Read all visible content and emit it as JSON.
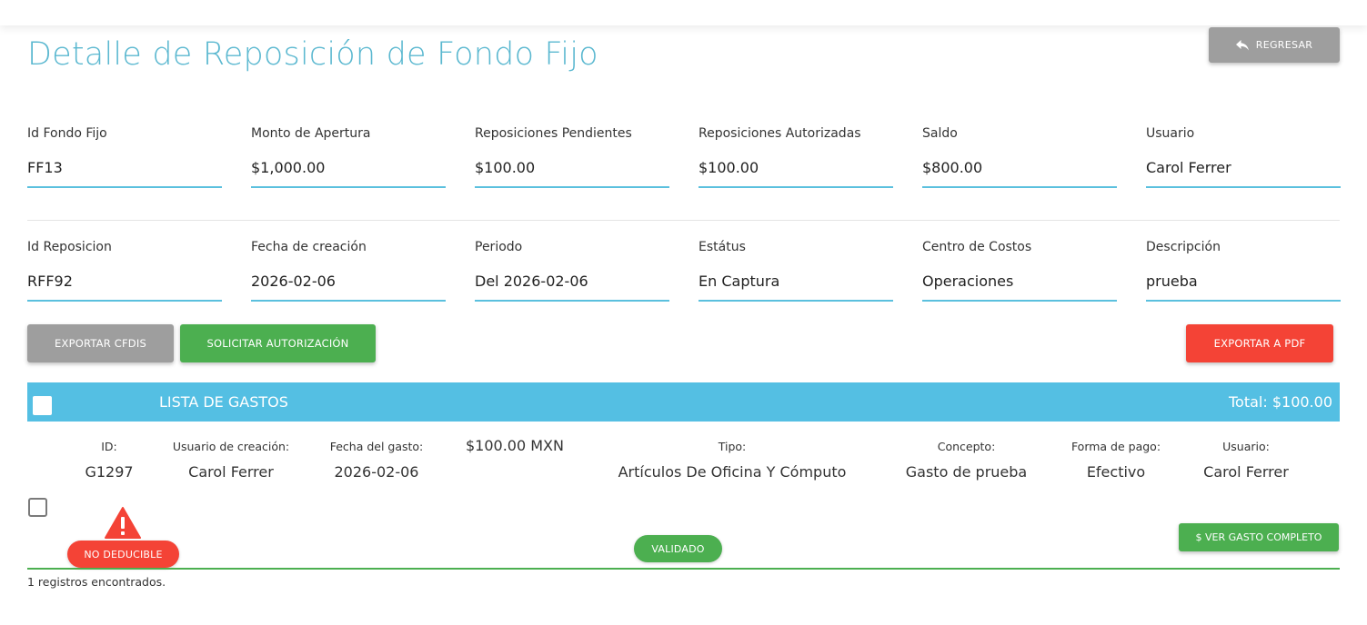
{
  "page": {
    "title": "Detalle de Reposición de Fondo Fijo",
    "back_label": "REGRESAR"
  },
  "summary": {
    "row1": [
      {
        "label": "Id Fondo Fijo",
        "value": "FF13"
      },
      {
        "label": "Monto de Apertura",
        "value": "$1,000.00"
      },
      {
        "label": "Reposiciones Pendientes",
        "value": "$100.00"
      },
      {
        "label": "Reposiciones Autorizadas",
        "value": "$100.00"
      },
      {
        "label": "Saldo",
        "value": "$800.00"
      },
      {
        "label": "Usuario",
        "value": "Carol Ferrer"
      }
    ],
    "row2": [
      {
        "label": "Id Reposicion",
        "value": "RFF92"
      },
      {
        "label": "Fecha de creación",
        "value": "2026-02-06"
      },
      {
        "label": "Periodo",
        "value": "Del 2026-02-06"
      },
      {
        "label": "Estátus",
        "value": "En Captura"
      },
      {
        "label": "Centro de Costos",
        "value": "Operaciones"
      },
      {
        "label": "Descripción",
        "value": "prueba"
      }
    ]
  },
  "actions": {
    "export_cfdis": "EXPORTAR CFDIS",
    "request_auth": "SOLICITAR AUTORIZACIÓN",
    "export_pdf": "EXPORTAR A PDF"
  },
  "expense_list": {
    "title": "LISTA DE GASTOS",
    "total": "Total: $100.00",
    "items": [
      {
        "id_label": "ID:",
        "id": "G1297",
        "created_by_label": "Usuario de creación:",
        "created_by": "Carol Ferrer",
        "date_label": "Fecha del gasto:",
        "date": "2026-02-06",
        "amount": "$100.00 MXN",
        "type_label": "Tipo:",
        "type": "Artículos De Oficina Y Cómputo",
        "concept_label": "Concepto:",
        "concept": "Gasto de prueba",
        "payment_label": "Forma de pago:",
        "payment": "Efectivo",
        "user_label": "Usuario:",
        "user": "Carol Ferrer",
        "deductible_badge": "NO DEDUCIBLE",
        "status_badge": "VALIDADO",
        "view_label": "$ VER GASTO COMPLETO"
      }
    ]
  },
  "footer": {
    "records": "1 registros encontrados."
  },
  "colors": {
    "title": "#5bb8d0",
    "underline": "#5bc0de",
    "list_header": "#54bfe3",
    "grey_button": "#9e9e9e",
    "green": "#4caf50",
    "red": "#f44336"
  },
  "icons": {
    "back": "reply-arrow-icon",
    "warning": "warning-triangle-icon"
  }
}
